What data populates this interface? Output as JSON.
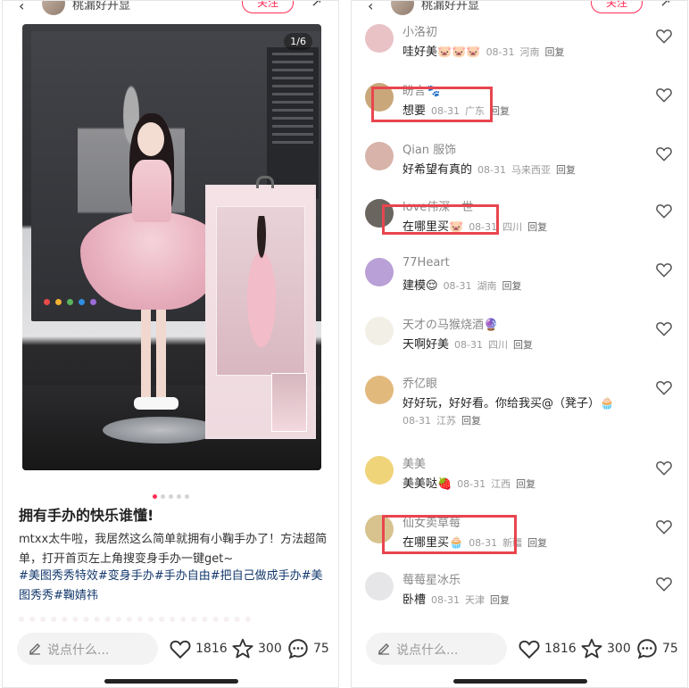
{
  "left": {
    "header": {
      "author": "桃漏好开显",
      "follow_label": "关注"
    },
    "photo": {
      "counter": "1/6",
      "dot_colors": [
        "#e84a4a",
        "#f2b233",
        "#5ab55e",
        "#2f8ee0",
        "#9b6bd8"
      ]
    },
    "pager": {
      "total": 5,
      "active_index": 0
    },
    "note": {
      "title": "拥有手办的快乐谁懂!",
      "body": "mtxx太牛啦，我居然这么简单就拥有小鞠手办了！方法超简单，打开首页左上角搜变身手办一键get~",
      "tags": [
        "#美图秀秀特效",
        "#变身手办",
        "#手办自由",
        "#把自己做成手办",
        "#美图秀秀",
        "#鞠婧祎"
      ]
    },
    "bottom": {
      "comment_placeholder": "说点什么...",
      "likes": "1816",
      "stars": "300",
      "comments": "75"
    }
  },
  "right": {
    "header": {
      "author": "桃漏好开显",
      "follow_label": "关注"
    },
    "comments": [
      {
        "name": "小洛初",
        "text": "哇好美🐷🐷🐷",
        "date": "08-31",
        "region": "河南",
        "reply": "回复",
        "avatar_color": "#e9c2c6"
      },
      {
        "name": "盼言🐾",
        "text": "想要",
        "date": "08-31",
        "region": "广东",
        "reply": "回复",
        "avatar_color": "#c9a77a"
      },
      {
        "name": "Qian 服饰",
        "text": "好希望有真的",
        "date": "08-31",
        "region": "马来西亚",
        "reply": "回复",
        "avatar_color": "#d7b3a9"
      },
      {
        "name": "love伟深一世",
        "text": "在哪里买🐷",
        "date": "08-31",
        "region": "四川",
        "reply": "回复",
        "avatar_color": "#6b6560"
      },
      {
        "name": "77Heart",
        "text": "建模😌",
        "date": "08-31",
        "region": "湖南",
        "reply": "回复",
        "avatar_color": "#b9a0d6"
      },
      {
        "name": "天才の马猴烧酒🔮",
        "text": "天啊好美",
        "date": "08-31",
        "region": "四川",
        "reply": "回复",
        "avatar_color": "#f2efe6"
      },
      {
        "name": "乔亿眼",
        "text": "好好玩，好好看。你给我买@（凳子）🧁",
        "date": "08-31",
        "region": "江苏",
        "reply": "回复",
        "avatar_color": "#e2b97d"
      },
      {
        "name": "美美",
        "text": "美美哒🍓",
        "date": "08-31",
        "region": "江西",
        "reply": "回复",
        "avatar_color": "#f0d47a"
      },
      {
        "name": "仙女卖草莓",
        "text": "在哪里买🧁",
        "date": "08-31",
        "region": "新疆",
        "reply": "回复",
        "avatar_color": "#d8c28e"
      },
      {
        "name": "莓莓星冰乐",
        "text": "卧槽",
        "date": "08-31",
        "region": "天津",
        "reply": "回复",
        "avatar_color": "#e6e6e8"
      }
    ],
    "bottom": {
      "comment_placeholder": "说点什么...",
      "likes": "1816",
      "stars": "300",
      "comments": "75"
    }
  },
  "colors": {
    "accent": "#ff2d55",
    "tag_link": "#13386c",
    "highlight_box": "#e8454f"
  }
}
